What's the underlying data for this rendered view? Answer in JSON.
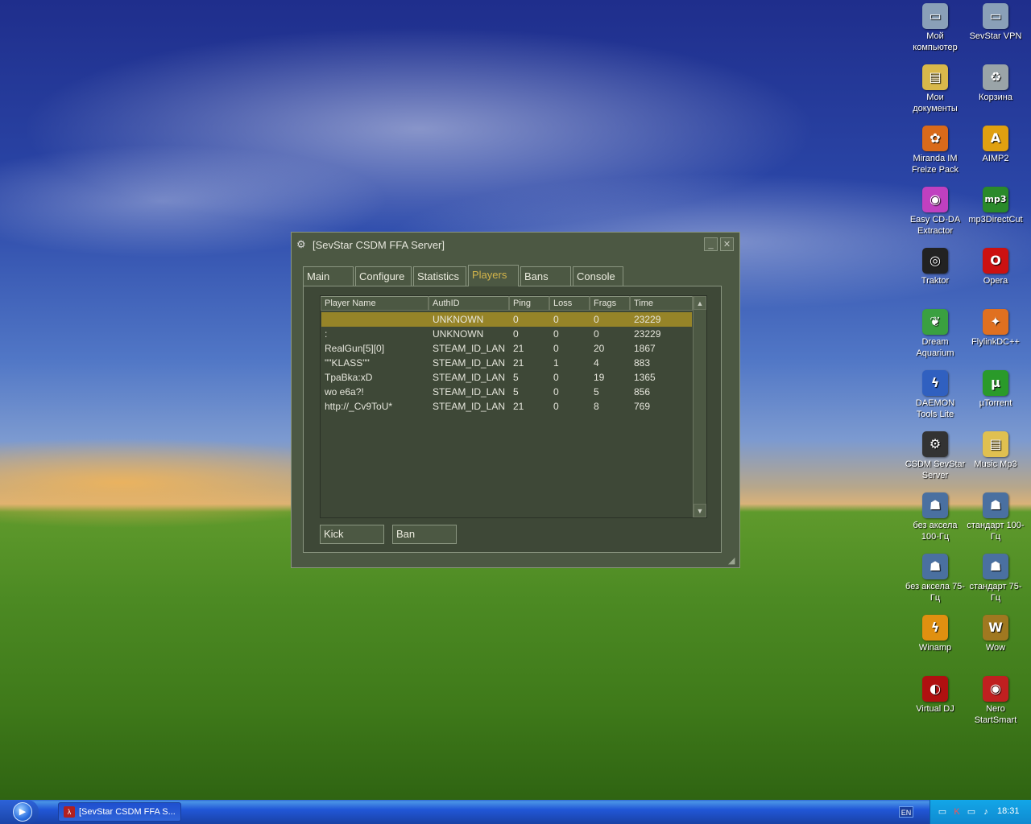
{
  "desktop_icons": [
    {
      "label": "Мой компьютер",
      "icon": "my-computer-icon",
      "color": "#8aa0b8",
      "glyph": "▭"
    },
    {
      "label": "SevStar VPN",
      "icon": "network-icon",
      "color": "#8aa0b8",
      "glyph": "▭"
    },
    {
      "label": "Мои документы",
      "icon": "my-documents-icon",
      "color": "#d9b84a",
      "glyph": "▤"
    },
    {
      "label": "Корзина",
      "icon": "recycle-bin-icon",
      "color": "#9aa4a8",
      "glyph": "♻"
    },
    {
      "label": "Miranda IM Freize Pack",
      "icon": "miranda-icon",
      "color": "#d96a1a",
      "glyph": "✿"
    },
    {
      "label": "AIMP2",
      "icon": "aimp-icon",
      "color": "#e0a010",
      "glyph": "A"
    },
    {
      "label": "Easy CD-DA Extractor",
      "icon": "cd-extractor-icon",
      "color": "#c040c0",
      "glyph": "◉"
    },
    {
      "label": "mp3DirectCut",
      "icon": "mp3directcut-icon",
      "color": "#2a8a2a",
      "glyph": "mp3"
    },
    {
      "label": "Traktor",
      "icon": "traktor-icon",
      "color": "#222222",
      "glyph": "◎"
    },
    {
      "label": "Opera",
      "icon": "opera-icon",
      "color": "#cc1111",
      "glyph": "O"
    },
    {
      "label": "Dream Aquarium",
      "icon": "aquarium-icon",
      "color": "#3aa040",
      "glyph": "❦"
    },
    {
      "label": "FlylinkDC++",
      "icon": "flylink-icon",
      "color": "#e07020",
      "glyph": "✦"
    },
    {
      "label": "DAEMON Tools Lite",
      "icon": "daemon-tools-icon",
      "color": "#3060c0",
      "glyph": "ϟ"
    },
    {
      "label": "µTorrent",
      "icon": "utorrent-icon",
      "color": "#2a9a2a",
      "glyph": "µ"
    },
    {
      "label": "CSDM SevStar Server",
      "icon": "steam-icon",
      "color": "#333333",
      "glyph": "⚙"
    },
    {
      "label": "Music Mp3",
      "icon": "folder-icon",
      "color": "#e0c050",
      "glyph": "▤"
    },
    {
      "label": "без аксела 100-Гц",
      "icon": "counter-strike-icon",
      "color": "#4a70a0",
      "glyph": "☗"
    },
    {
      "label": "стандарт 100-Гц",
      "icon": "counter-strike-icon",
      "color": "#4a70a0",
      "glyph": "☗"
    },
    {
      "label": "без аксела 75-Гц",
      "icon": "counter-strike-icon",
      "color": "#4a70a0",
      "glyph": "☗"
    },
    {
      "label": "стандарт 75-Гц",
      "icon": "counter-strike-icon",
      "color": "#4a70a0",
      "glyph": "☗"
    },
    {
      "label": "Winamp",
      "icon": "winamp-icon",
      "color": "#e09010",
      "glyph": "ϟ"
    },
    {
      "label": "Wow",
      "icon": "wow-icon",
      "color": "#a07820",
      "glyph": "W"
    },
    {
      "label": "Virtual DJ",
      "icon": "virtual-dj-icon",
      "color": "#b01010",
      "glyph": "◐"
    },
    {
      "label": "Nero StartSmart",
      "icon": "nero-icon",
      "color": "#c02020",
      "glyph": "◉"
    }
  ],
  "window": {
    "title": "[SevStar CSDM FFA Server]",
    "minimize": "_",
    "close": "✕",
    "tabs": [
      "Main",
      "Configure",
      "Statistics",
      "Players",
      "Bans",
      "Console"
    ],
    "active_tab": "Players",
    "columns": [
      "Player Name",
      "AuthID",
      "Ping",
      "Loss",
      "Frags",
      "Time"
    ],
    "rows": [
      [
        "",
        "UNKNOWN",
        "0",
        "0",
        "0",
        "23229"
      ],
      [
        ":",
        "UNKNOWN",
        "0",
        "0",
        "0",
        "23229"
      ],
      [
        "RealGun[5][0]",
        "STEAM_ID_LAN",
        "21",
        "0",
        "20",
        "1867"
      ],
      [
        "\"\"KLASS\"\"",
        "STEAM_ID_LAN",
        "21",
        "1",
        "4",
        "883"
      ],
      [
        "TpaBka:xD",
        "STEAM_ID_LAN",
        "5",
        "0",
        "19",
        "1365"
      ],
      [
        "wo e6a?!",
        "STEAM_ID_LAN",
        "5",
        "0",
        "5",
        "856"
      ],
      [
        "http://_Cv9ToU*",
        "STEAM_ID_LAN",
        "21",
        "0",
        "8",
        "769"
      ]
    ],
    "kick_label": "Kick",
    "ban_label": "Ban",
    "accent": "#968428"
  },
  "taskbar": {
    "task_label": "[SevStar CSDM FFA S...",
    "lang": "EN",
    "clock": "18:31"
  }
}
